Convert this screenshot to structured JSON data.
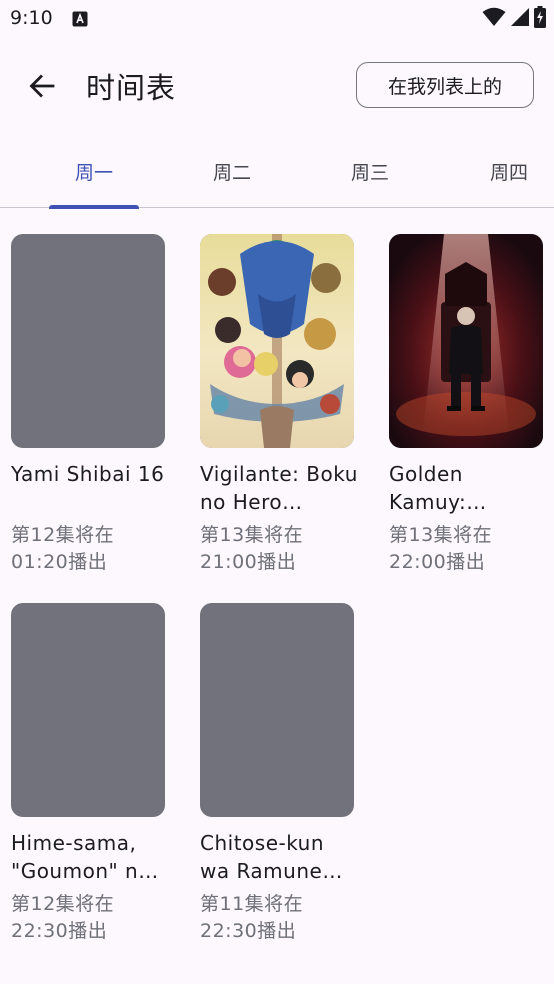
{
  "status_bar": {
    "time": "9:10",
    "notification_icon": "a-letter-icon",
    "icons": [
      "wifi-icon",
      "signal-icon",
      "battery-charging-icon"
    ]
  },
  "header": {
    "back_icon": "arrow-back-icon",
    "title": "时间表",
    "on_list_button": "在我列表上的"
  },
  "tabs": [
    {
      "label": "周一",
      "selected": true
    },
    {
      "label": "周二",
      "selected": false
    },
    {
      "label": "周三",
      "selected": false
    },
    {
      "label": "周四",
      "selected": false
    }
  ],
  "shows": [
    {
      "title": "Yami Shibai 16",
      "airing": "第12集将在01:20播出",
      "poster": "placeholder"
    },
    {
      "title": "Vigilante: Boku no Hero Academia Illegals",
      "airing": "第13集将在21:00播出",
      "poster": "illustration"
    },
    {
      "title": "Golden Kamuy: Saishuushou",
      "airing": "第13集将在22:00播出",
      "poster": "illustration"
    },
    {
      "title": "Hime-sama, \"Goumon\" no Jikan desu",
      "airing": "第12集将在22:30播出",
      "poster": "placeholder"
    },
    {
      "title": "Chitose-kun wa Ramune Bin no Naka",
      "airing": "第11集将在22:30播出",
      "poster": "placeholder"
    }
  ],
  "colors": {
    "accent": "#3f51b5",
    "background": "#fcf8fd",
    "placeholder": "#71727b",
    "secondary_text": "#6f7079"
  }
}
